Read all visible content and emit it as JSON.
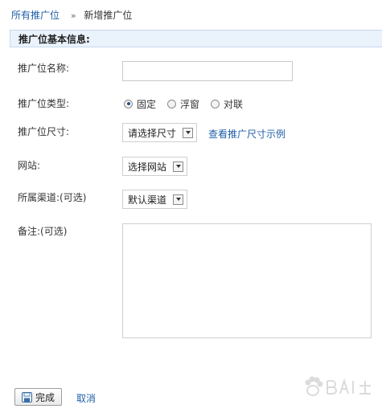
{
  "breadcrumb": {
    "parent": "所有推广位",
    "separator": "»",
    "current": "新增推广位"
  },
  "section": {
    "title": "推广位基本信息:"
  },
  "form": {
    "name": {
      "label": "推广位名称:",
      "value": ""
    },
    "type": {
      "label": "推广位类型:",
      "options": [
        "固定",
        "浮窗",
        "对联"
      ],
      "selected": "固定"
    },
    "size": {
      "label": "推广位尺寸:",
      "selected": "请选择尺寸",
      "example_link": "查看推广尺寸示例"
    },
    "site": {
      "label": "网站:",
      "selected": "选择网站"
    },
    "channel": {
      "label": "所属渠道:(可选)",
      "selected": "默认渠道"
    },
    "note": {
      "label": "备注:(可选)",
      "value": ""
    }
  },
  "actions": {
    "done_label": "完成",
    "cancel_label": "取消"
  },
  "colors": {
    "link": "#1f5fa8",
    "section_bg": "#eaf2fb",
    "section_border": "#c5d9ee"
  },
  "icons": {
    "done_button": "save-icon",
    "watermark": "baidu-jingyan-logo"
  }
}
